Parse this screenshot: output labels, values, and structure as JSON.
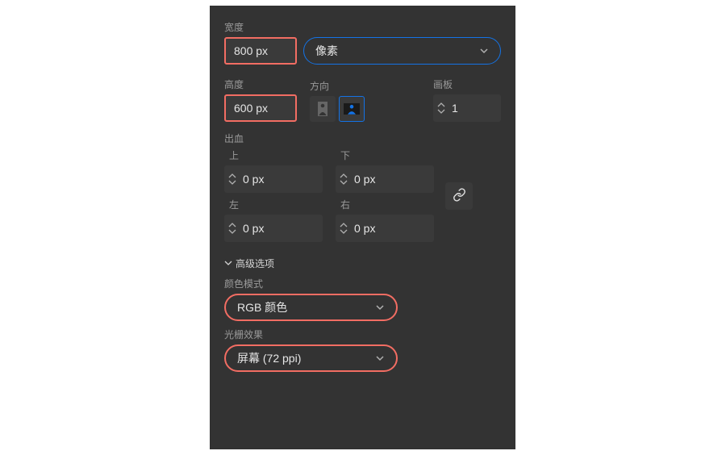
{
  "width": {
    "label": "宽度",
    "value": "800 px",
    "unit": "像素"
  },
  "height": {
    "label": "高度",
    "value": "600 px"
  },
  "orientation": {
    "label": "方向"
  },
  "artboards": {
    "label": "画板",
    "value": "1"
  },
  "bleed": {
    "label": "出血",
    "top": {
      "label": "上",
      "value": "0 px"
    },
    "bottom": {
      "label": "下",
      "value": "0 px"
    },
    "left": {
      "label": "左",
      "value": "0 px"
    },
    "right": {
      "label": "右",
      "value": "0 px"
    }
  },
  "advanced": {
    "label": "高级选项"
  },
  "colorMode": {
    "label": "颜色模式",
    "value": "RGB 颜色"
  },
  "raster": {
    "label": "光栅效果",
    "value": "屏幕 (72 ppi)"
  }
}
